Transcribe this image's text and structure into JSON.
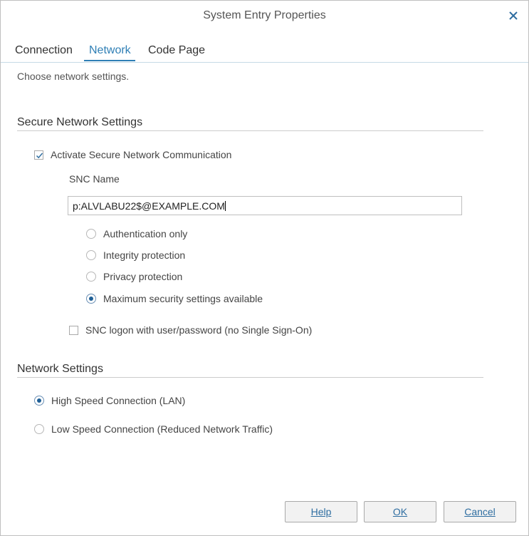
{
  "window": {
    "title": "System Entry Properties"
  },
  "tabs": [
    {
      "label": "Connection"
    },
    {
      "label": "Network"
    },
    {
      "label": "Code Page"
    }
  ],
  "active_tab": "Network",
  "description": "Choose network settings.",
  "secure": {
    "title": "Secure Network Settings",
    "activate_label": "Activate Secure Network Communication",
    "activate_checked": true,
    "snc_name_label": "SNC Name",
    "snc_name_value": "p:ALVLABU22$@EXAMPLE.COM",
    "protection_options": [
      {
        "label": "Authentication only",
        "selected": false
      },
      {
        "label": "Integrity protection",
        "selected": false
      },
      {
        "label": "Privacy protection",
        "selected": false
      },
      {
        "label": "Maximum security settings available",
        "selected": true
      }
    ],
    "snc_logon_label": "SNC logon with user/password (no Single Sign-On)",
    "snc_logon_checked": false
  },
  "network": {
    "title": "Network Settings",
    "options": [
      {
        "label": "High Speed Connection (LAN)",
        "selected": true
      },
      {
        "label": "Low Speed Connection (Reduced Network Traffic)",
        "selected": false
      }
    ]
  },
  "buttons": {
    "help": {
      "label": "Help"
    },
    "ok": {
      "label": "OK"
    },
    "cancel": {
      "label": "Cancel"
    }
  },
  "colors": {
    "accent": "#2f7fb5",
    "radio_selected": "#1f5f96"
  }
}
